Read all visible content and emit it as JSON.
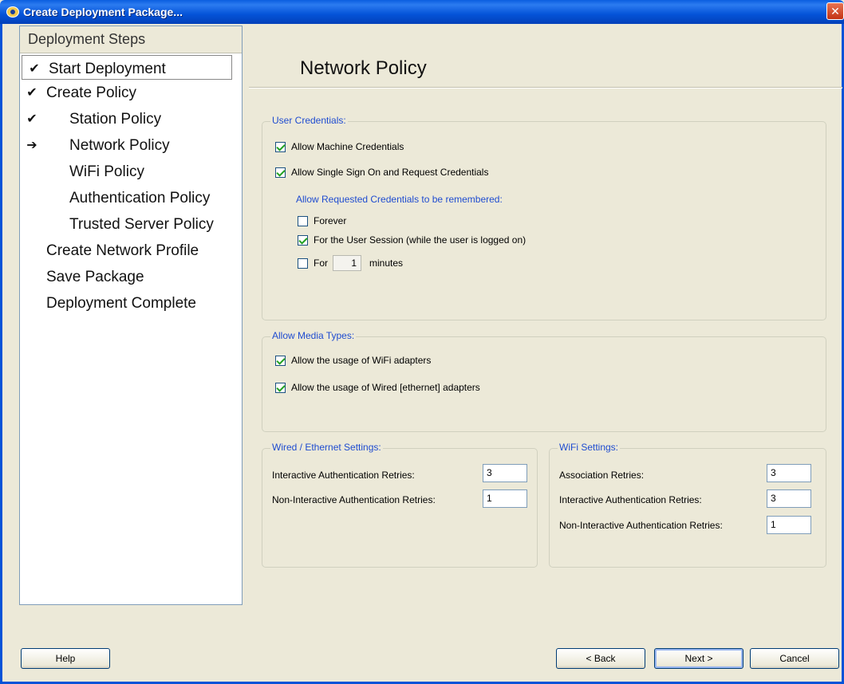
{
  "window": {
    "title": "Create Deployment Package...",
    "close": "✕"
  },
  "steps": {
    "header": "Deployment Steps",
    "items": [
      {
        "label": "Start Deployment",
        "mark": "✔",
        "sub": false
      },
      {
        "label": "Create Policy",
        "mark": "✔",
        "sub": false
      },
      {
        "label": "Station Policy",
        "mark": "✔",
        "sub": true
      },
      {
        "label": "Network Policy",
        "mark": "➔",
        "sub": true
      },
      {
        "label": "WiFi Policy",
        "mark": "",
        "sub": true
      },
      {
        "label": "Authentication Policy",
        "mark": "",
        "sub": true
      },
      {
        "label": "Trusted Server Policy",
        "mark": "",
        "sub": true
      },
      {
        "label": "Create Network Profile",
        "mark": "",
        "sub": false
      },
      {
        "label": "Save Package",
        "mark": "",
        "sub": false
      },
      {
        "label": "Deployment Complete",
        "mark": "",
        "sub": false
      }
    ]
  },
  "main": {
    "title": "Network Policy",
    "user_credentials": {
      "title": "User Credentials:",
      "allow_machine": {
        "label": "Allow Machine Credentials",
        "checked": true
      },
      "allow_sso": {
        "label": "Allow Single Sign On and Request Credentials",
        "checked": true
      },
      "remember_heading": "Allow Requested Credentials to be remembered:",
      "forever": {
        "label": "Forever",
        "checked": false
      },
      "user_session": {
        "label": "For the User Session (while the user is logged on)",
        "checked": true
      },
      "for_minutes": {
        "label": "For",
        "value": "1",
        "unit": "minutes",
        "checked": false
      }
    },
    "media_types": {
      "title": "Allow Media Types:",
      "wifi": {
        "label": "Allow the usage of WiFi adapters",
        "checked": true
      },
      "wired": {
        "label": "Allow the usage of Wired [ethernet] adapters",
        "checked": true
      }
    },
    "wired_settings": {
      "title": "Wired / Ethernet Settings:",
      "interactive_label": "Interactive Authentication Retries:",
      "interactive_value": "3",
      "non_interactive_label": "Non-Interactive Authentication Retries:",
      "non_interactive_value": "1"
    },
    "wifi_settings": {
      "title": "WiFi Settings:",
      "association_label": "Association Retries:",
      "association_value": "3",
      "interactive_label": "Interactive Authentication Retries:",
      "interactive_value": "3",
      "non_interactive_label": "Non-Interactive Authentication Retries:",
      "non_interactive_value": "1"
    }
  },
  "buttons": {
    "help": "Help",
    "back": "< Back",
    "next": "Next >",
    "cancel": "Cancel"
  }
}
